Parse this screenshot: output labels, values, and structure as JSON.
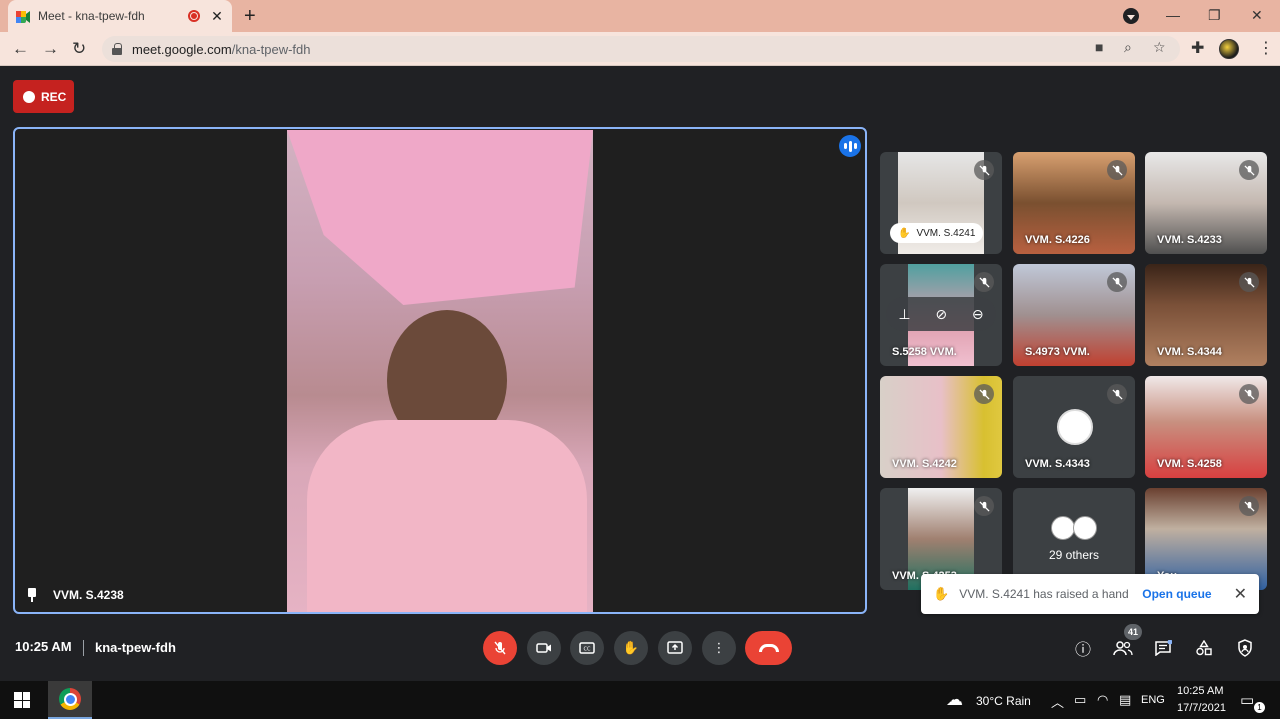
{
  "browser": {
    "tab_title": "Meet - kna-tpew-fdh",
    "tab_close": "✕",
    "new_tab": "+",
    "url_host": "meet.google.com",
    "url_path": "/kna-tpew-fdh",
    "window": {
      "minimize": "—",
      "maximize": "❐",
      "close": "✕"
    }
  },
  "meet": {
    "rec_label": "REC",
    "main_participant": "VVM. S.4238",
    "tiles": [
      {
        "name": "VVM. S.4241",
        "hand_raised": true
      },
      {
        "name": "VVM. S.4226"
      },
      {
        "name": "VVM. S.4233"
      },
      {
        "name": "S.5258 VVM."
      },
      {
        "name": "S.4973 VVM."
      },
      {
        "name": "VVM. S.4344"
      },
      {
        "name": "VVM. S.4242"
      },
      {
        "name": "VVM. S.4343"
      },
      {
        "name": "VVM. S.4258"
      },
      {
        "name": "VVM. S.4253"
      },
      {
        "name": "29 others"
      },
      {
        "name": "You"
      }
    ],
    "toast": {
      "message": "VVM. S.4241 has raised a hand",
      "action": "Open queue"
    },
    "time": "10:25 AM",
    "meeting_code": "kna-tpew-fdh",
    "participant_count": "41"
  },
  "taskbar": {
    "weather": "30°C  Rain",
    "language": "ENG",
    "clock_time": "10:25 AM",
    "clock_date": "17/7/2021",
    "notifications": "1"
  },
  "colors": {
    "meet_bg": "#202124",
    "accent_blue": "#1a73e8",
    "danger_red": "#ea4335",
    "tab_strip": "#e8b4a2"
  }
}
